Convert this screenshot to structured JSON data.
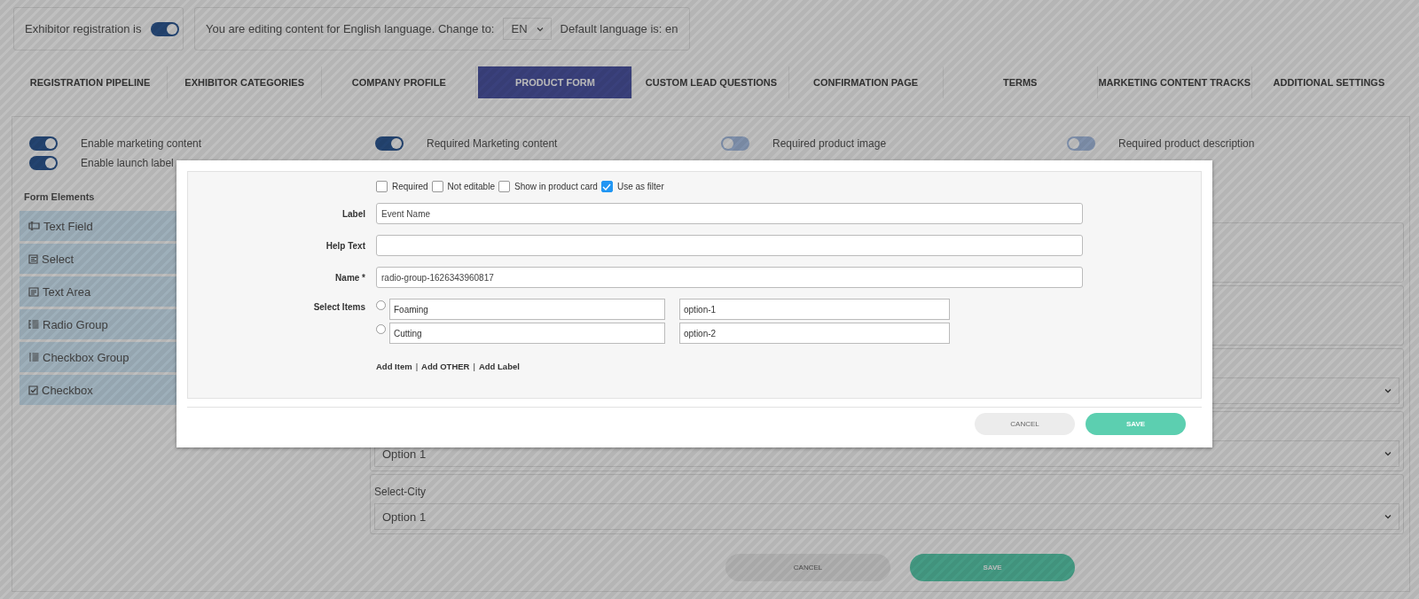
{
  "header": {
    "registration_label": "Exhibitor registration is",
    "registration_on": true,
    "language_text": "You are editing content for English language. Change to:",
    "language_value": "EN",
    "default_language_text": "Default language is: en"
  },
  "tabs": [
    {
      "label": "REGISTRATION PIPELINE",
      "selected": false
    },
    {
      "label": "EXHIBITOR CATEGORIES",
      "selected": false
    },
    {
      "label": "COMPANY PROFILE",
      "selected": false
    },
    {
      "label": "PRODUCT FORM",
      "selected": true
    },
    {
      "label": "CUSTOM LEAD QUESTIONS",
      "selected": false
    },
    {
      "label": "CONFIRMATION PAGE",
      "selected": false
    },
    {
      "label": "TERMS",
      "selected": false
    },
    {
      "label": "MARKETING CONTENT TRACKS",
      "selected": false
    },
    {
      "label": "ADDITIONAL SETTINGS",
      "selected": false
    }
  ],
  "settings": [
    {
      "label": "Enable marketing content",
      "on": true
    },
    {
      "label": "Required Marketing content",
      "on": true
    },
    {
      "label": "Required product image",
      "on": false
    },
    {
      "label": "Required product description",
      "on": false
    },
    {
      "label": "Enable launch label",
      "on": true
    }
  ],
  "form_elements": {
    "title": "Form Elements",
    "items": [
      {
        "label": "Text Field",
        "kind": "text_field"
      },
      {
        "label": "Select",
        "kind": "select"
      },
      {
        "label": "Text Area",
        "kind": "text_area"
      },
      {
        "label": "Radio Group",
        "kind": "radio_group"
      },
      {
        "label": "Checkbox Group",
        "kind": "checkbox_group"
      },
      {
        "label": "Checkbox",
        "kind": "checkbox"
      }
    ]
  },
  "preview": {
    "fields": [
      {
        "kind": "card"
      },
      {
        "kind": "card"
      },
      {
        "kind": "select"
      },
      {
        "kind": "select",
        "value": "Option 1"
      },
      {
        "kind": "select",
        "label": "Select-City",
        "value": "Option 1"
      }
    ]
  },
  "actions": [
    {
      "label": "CANCEL",
      "kind": "secondary"
    },
    {
      "label": "SAVE",
      "kind": "primary"
    }
  ],
  "modal": {
    "options": [
      {
        "label": "Required",
        "checked": false
      },
      {
        "label": "Not editable",
        "checked": false
      },
      {
        "label": "Show in product card",
        "checked": false
      },
      {
        "label": "Use as filter",
        "checked": true
      }
    ],
    "fields": [
      {
        "label": "Label",
        "value": "Event Name"
      },
      {
        "label": "Help Text"
      },
      {
        "label": "Name *",
        "value": "radio-group-1626343960817"
      }
    ],
    "items_label": "Select Items",
    "items": [
      {
        "label": "Foaming",
        "value": "option-1",
        "selected": false
      },
      {
        "label": "Cutting",
        "value": "option-2",
        "selected": false
      }
    ],
    "links": [
      "Add Item",
      "Add OTHER",
      "Add Label"
    ],
    "link_separator": "|",
    "buttons": [
      {
        "label": "CANCEL",
        "kind": "secondary"
      },
      {
        "label": "SAVE",
        "kind": "primary"
      }
    ]
  }
}
